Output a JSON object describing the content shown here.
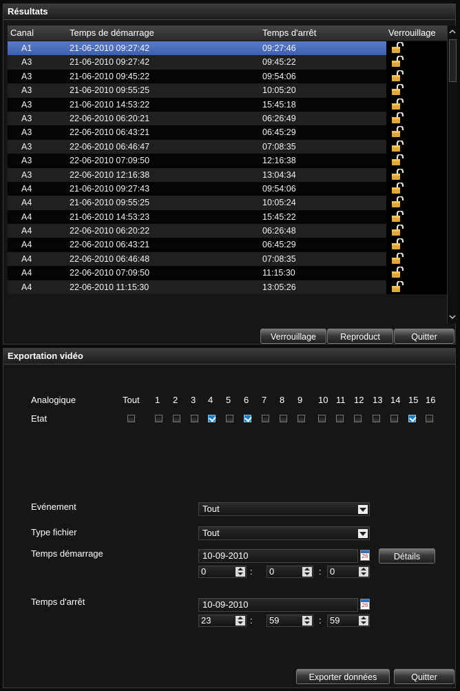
{
  "results": {
    "title": "Résultats",
    "columns": [
      "Canal",
      "Temps de démarrage",
      "Temps d'arrêt",
      "Verrouillage"
    ],
    "rows": [
      {
        "canal": "A1",
        "start": "21-06-2010 09:27:42",
        "stop": "09:27:46",
        "selected": true
      },
      {
        "canal": "A3",
        "start": "21-06-2010 09:27:42",
        "stop": "09:45:22"
      },
      {
        "canal": "A3",
        "start": "21-06-2010 09:45:22",
        "stop": "09:54:06"
      },
      {
        "canal": "A3",
        "start": "21-06-2010 09:55:25",
        "stop": "10:05:20"
      },
      {
        "canal": "A3",
        "start": "21-06-2010 14:53:22",
        "stop": "15:45:18"
      },
      {
        "canal": "A3",
        "start": "22-06-2010 06:20:21",
        "stop": "06:26:49"
      },
      {
        "canal": "A3",
        "start": "22-06-2010 06:43:21",
        "stop": "06:45:29"
      },
      {
        "canal": "A3",
        "start": "22-06-2010 06:46:47",
        "stop": "07:08:35"
      },
      {
        "canal": "A3",
        "start": "22-06-2010 07:09:50",
        "stop": "12:16:38"
      },
      {
        "canal": "A3",
        "start": "22-06-2010 12:16:38",
        "stop": "13:04:34"
      },
      {
        "canal": "A4",
        "start": "21-06-2010 09:27:43",
        "stop": "09:54:06"
      },
      {
        "canal": "A4",
        "start": "21-06-2010 09:55:25",
        "stop": "10:05:24"
      },
      {
        "canal": "A4",
        "start": "21-06-2010 14:53:23",
        "stop": "15:45:22"
      },
      {
        "canal": "A4",
        "start": "22-06-2010 06:20:22",
        "stop": "06:26:48"
      },
      {
        "canal": "A4",
        "start": "22-06-2010 06:43:21",
        "stop": "06:45:29"
      },
      {
        "canal": "A4",
        "start": "22-06-2010 06:46:48",
        "stop": "07:08:35"
      },
      {
        "canal": "A4",
        "start": "22-06-2010 07:09:50",
        "stop": "11:15:30"
      },
      {
        "canal": "A4",
        "start": "22-06-2010 11:15:30",
        "stop": "13:05:26"
      }
    ],
    "lock_icon": "padlock-open-icon",
    "buttons": {
      "lock": "Verrouillage",
      "play": "Reproduct",
      "quit": "Quitter"
    }
  },
  "export": {
    "title": "Exportation vidéo",
    "analog_label": "Analogique",
    "state_label": "Etat",
    "channels": [
      "Tout",
      "1",
      "2",
      "3",
      "4",
      "5",
      "6",
      "7",
      "8",
      "9",
      "10",
      "11",
      "12",
      "13",
      "14",
      "15",
      "16"
    ],
    "checked": [
      false,
      false,
      false,
      false,
      true,
      false,
      true,
      false,
      false,
      false,
      false,
      false,
      false,
      false,
      false,
      true,
      false
    ],
    "event_label": "Evénement",
    "event_value": "Tout",
    "filetype_label": "Type fichier",
    "filetype_value": "Tout",
    "start_label": "Temps démarrage",
    "start_date": "10-09-2010",
    "start_time": [
      "0",
      "0",
      "0"
    ],
    "details_button": "Détails",
    "stop_label": "Temps d'arrêt",
    "stop_date": "10-09-2010",
    "stop_time": [
      "23",
      "59",
      "59"
    ],
    "export_button": "Exporter données",
    "quit_button": "Quitter",
    "calendar_day": "26"
  }
}
